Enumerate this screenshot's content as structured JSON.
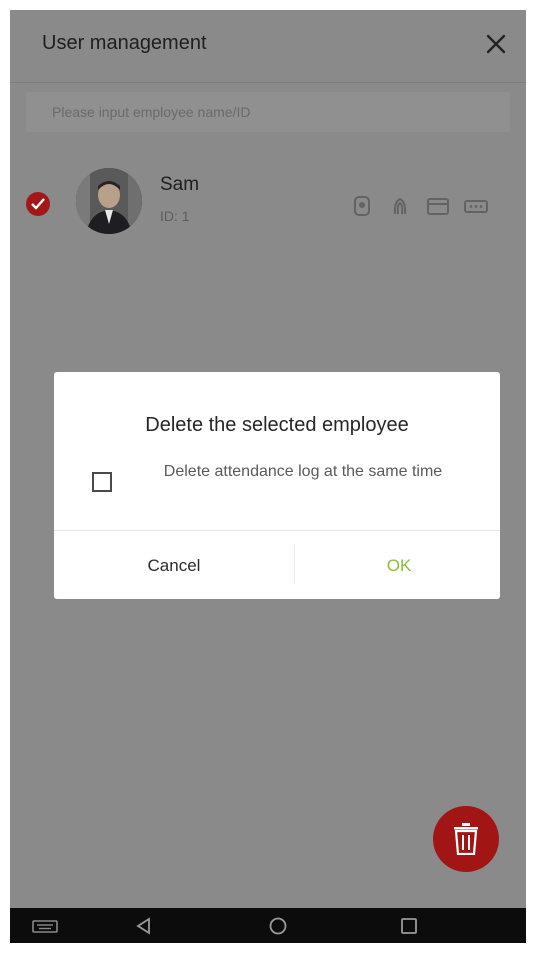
{
  "header": {
    "title": "User management"
  },
  "search": {
    "placeholder": "Please input employee name/ID"
  },
  "employees": [
    {
      "name": "Sam",
      "id_text": "ID: 1",
      "selected": true
    }
  ],
  "dialog": {
    "title": "Delete the selected employee",
    "checkbox_label": "Delete attendance log at the same time",
    "cancel_label": "Cancel",
    "ok_label": "OK"
  },
  "colors": {
    "accent_red": "#a21515",
    "ok_green": "#8bbd3a",
    "overlay": "#8a8a8a"
  },
  "icons": {
    "close": "close-icon",
    "fab": "trash-icon",
    "auth": [
      "face-icon",
      "fingerprint-icon",
      "card-icon",
      "password-icon"
    ],
    "nav": [
      "keyboard-icon",
      "back-icon",
      "home-icon",
      "recents-icon"
    ]
  }
}
